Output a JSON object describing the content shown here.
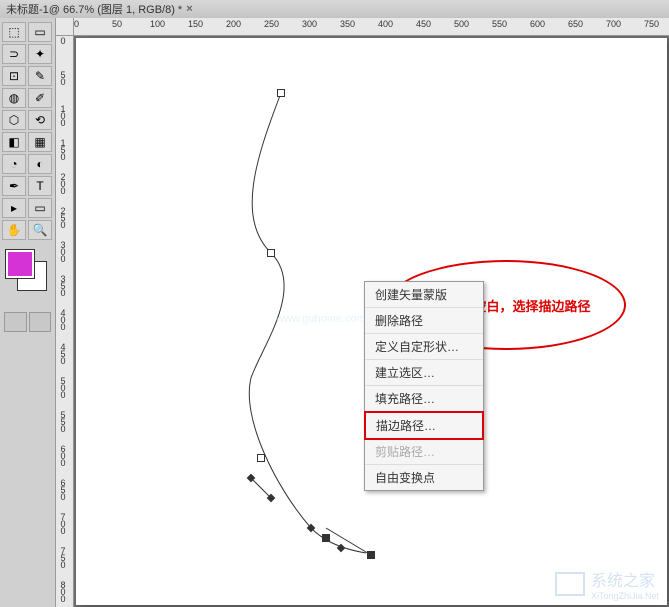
{
  "titlebar": {
    "document_title": "未标题-1@ 66.7% (图层 1, RGB/8) *",
    "close_glyph": "×"
  },
  "ruler_h": [
    "0",
    "50",
    "100",
    "150",
    "200",
    "250",
    "300",
    "350",
    "400",
    "450",
    "500",
    "550",
    "600",
    "650",
    "700",
    "750"
  ],
  "ruler_v": [
    "0",
    "50",
    "100",
    "150",
    "200",
    "250",
    "300",
    "350",
    "400",
    "450",
    "500",
    "550",
    "600",
    "650",
    "700",
    "750",
    "800"
  ],
  "tools": [
    [
      "move",
      "⬚",
      "selection",
      "▭"
    ],
    [
      "lasso",
      "⊃",
      "magic-wand",
      "✦"
    ],
    [
      "crop",
      "⊡",
      "eyedropper",
      "✎"
    ],
    [
      "heal",
      "◍",
      "brush",
      "✐"
    ],
    [
      "stamp",
      "⬡",
      "history-brush",
      "⟲"
    ],
    [
      "eraser",
      "◧",
      "gradient",
      "▦"
    ],
    [
      "blur",
      "◔",
      "dodge",
      "◐"
    ],
    [
      "pen",
      "✒",
      "type",
      "T"
    ],
    [
      "path-select",
      "▸",
      "shape",
      "▭"
    ],
    [
      "hand",
      "✋",
      "zoom",
      "🔍"
    ]
  ],
  "context_menu": {
    "items": [
      {
        "label": "创建矢量蒙版",
        "enabled": true
      },
      {
        "label": "删除路径",
        "enabled": true
      },
      {
        "label": "定义自定形状…",
        "enabled": true
      },
      {
        "label": "建立选区…",
        "enabled": true
      },
      {
        "label": "填充路径…",
        "enabled": true
      },
      {
        "label": "描边路径…",
        "enabled": true,
        "highlighted": true
      },
      {
        "label": "剪贴路径…",
        "enabled": false
      },
      {
        "label": "自由变换点",
        "enabled": true
      }
    ]
  },
  "callout": {
    "text": "右键点击空白，选择描边路径"
  },
  "watermark": {
    "text": "系统之家",
    "url": "XiTongZhiJia.Net"
  },
  "faint_watermark": "www.guhome.com"
}
